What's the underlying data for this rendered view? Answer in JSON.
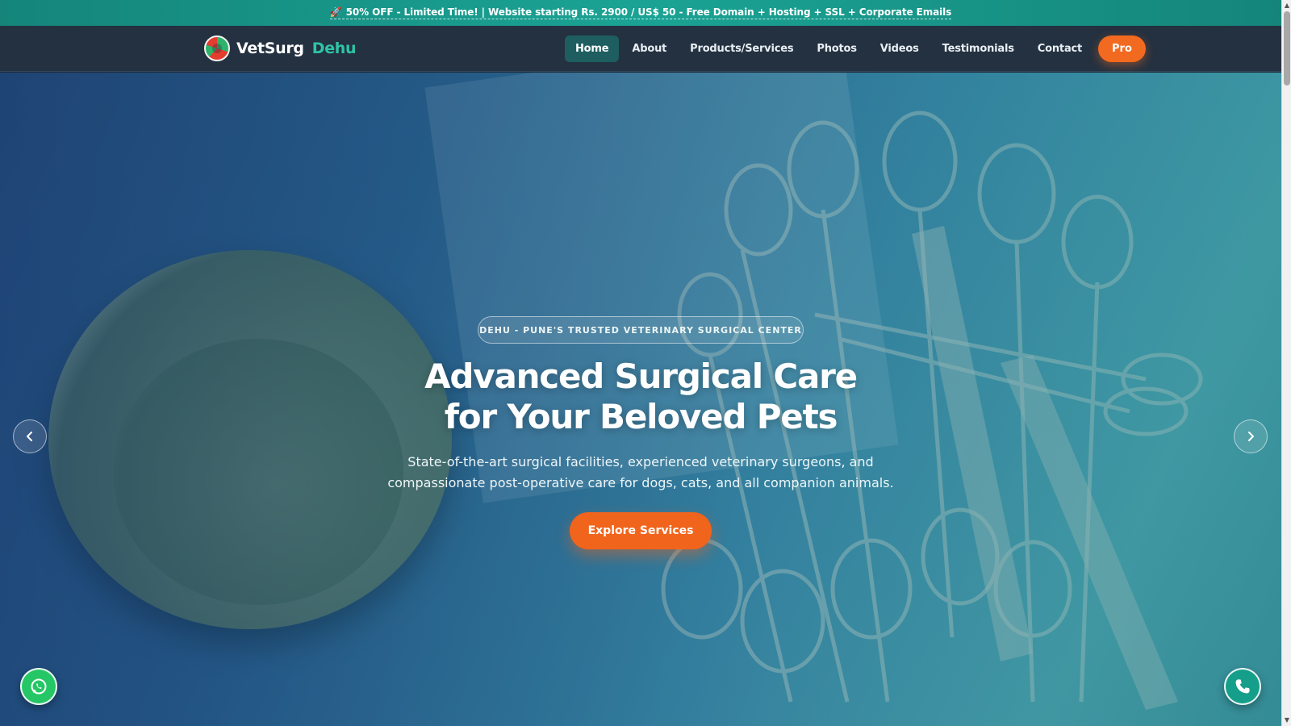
{
  "promo": {
    "icon": "rocket-icon",
    "text": "50% OFF - Limited Time! | Website starting Rs. 2900 / US$ 50 - Free Domain + Hosting + SSL + Corporate Emails"
  },
  "nav": {
    "brand_name": "VetSurg",
    "brand_accent": "Dehu",
    "items": [
      {
        "label": "Home",
        "active": true
      },
      {
        "label": "About"
      },
      {
        "label": "Products/Services"
      },
      {
        "label": "Photos"
      },
      {
        "label": "Videos"
      },
      {
        "label": "Testimonials"
      },
      {
        "label": "Contact"
      }
    ],
    "pro_label": "Pro"
  },
  "hero": {
    "badge": "DEHU - PUNE'S TRUSTED VETERINARY SURGICAL CENTER",
    "headline_line1": "Advanced Surgical Care",
    "headline_line2": "for Your Beloved Pets",
    "subtext_line1": "State-of-the-art surgical facilities, experienced veterinary surgeons, and",
    "subtext_line2": "compassionate post-operative care for dogs, cats, and all companion animals.",
    "cta_label": "Explore Services"
  },
  "colors": {
    "promo_bg": "#1aa394",
    "nav_bg": "#243140",
    "accent_teal": "#2ec4a6",
    "cta_orange": "#f1641c",
    "whatsapp_green": "#25c665",
    "call_teal": "#159f8b"
  },
  "icons": {
    "prev": "chevron-left-icon",
    "next": "chevron-right-icon",
    "whatsapp": "whatsapp-icon",
    "call": "phone-icon"
  }
}
